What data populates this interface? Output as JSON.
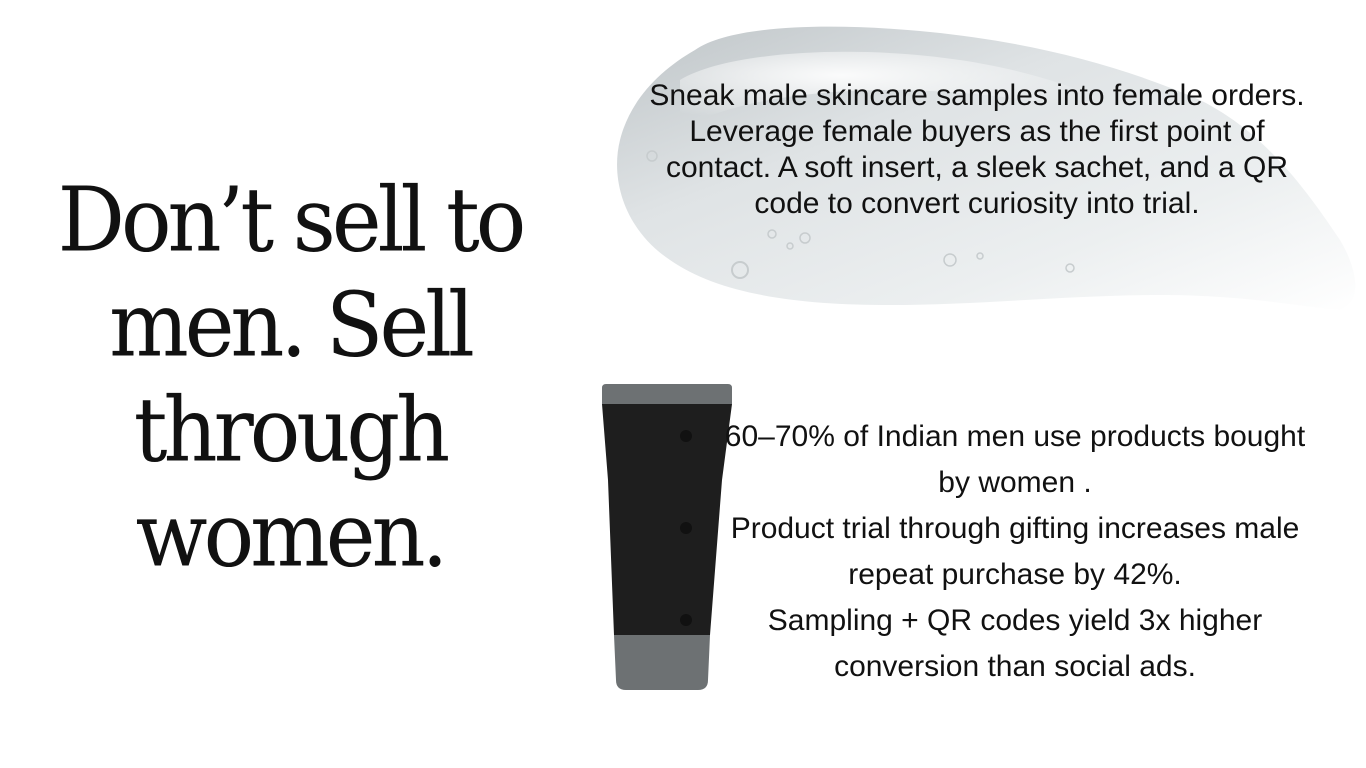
{
  "headline": "Don’t sell to men. Sell through women.",
  "gel_text": "Sneak male skincare samples into female orders. Leverage female buyers as the first point of contact. A soft insert, a sleek sachet, and a QR code to convert curiosity into trial.",
  "stats": [
    "60–70% of Indian men use products bought by women .",
    "Product trial through gifting increases male repeat purchase by 42%.",
    "Sampling + QR codes yield 3x higher conversion than social ads."
  ],
  "colors": {
    "text": "#111111",
    "tube_body": "#1e1e1e",
    "tube_cap": "#6d7173",
    "gel": "#d6dadc"
  },
  "decorations": [
    "clear-gel-swatch",
    "skincare-tube"
  ]
}
